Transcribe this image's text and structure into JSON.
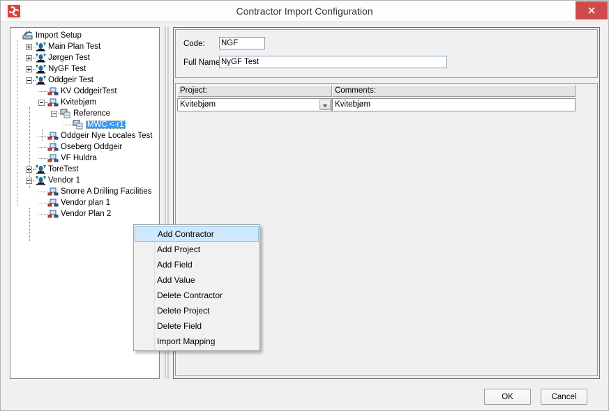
{
  "window": {
    "title": "Contractor Import Configuration",
    "app_icon": "app-logo-icon",
    "close_label": "✕"
  },
  "tree": {
    "root_label": "Import Setup",
    "nodes": [
      {
        "label": "Import Setup",
        "indent": 0,
        "icon": "import-setup-icon",
        "expander": "none",
        "selected": false
      },
      {
        "label": "Main Plan Test",
        "indent": 1,
        "icon": "contractor-icon",
        "expander": "plus",
        "selected": false
      },
      {
        "label": "Jørgen Test",
        "indent": 1,
        "icon": "contractor-icon",
        "expander": "plus",
        "selected": false
      },
      {
        "label": "NyGF Test",
        "indent": 1,
        "icon": "contractor-icon",
        "expander": "plus",
        "selected": false
      },
      {
        "label": "Oddgeir Test",
        "indent": 1,
        "icon": "contractor-icon",
        "expander": "minus",
        "selected": false
      },
      {
        "label": "KV OddgeirTest",
        "indent": 2,
        "icon": "project-icon",
        "expander": "none",
        "selected": false
      },
      {
        "label": "Kvitebjøm",
        "indent": 2,
        "icon": "project-icon",
        "expander": "minus",
        "selected": false
      },
      {
        "label": "Reference",
        "indent": 3,
        "icon": "field-icon",
        "expander": "minus",
        "selected": false
      },
      {
        "label": "MWC <-r1",
        "indent": 4,
        "icon": "field-icon",
        "expander": "none",
        "selected": true
      },
      {
        "label": "Oddgeir Nye Locales Test",
        "indent": 2,
        "icon": "project-icon",
        "expander": "none",
        "selected": false
      },
      {
        "label": "Oseberg Oddgeir",
        "indent": 2,
        "icon": "project-icon",
        "expander": "none",
        "selected": false
      },
      {
        "label": "VF Huldra",
        "indent": 2,
        "icon": "project-icon",
        "expander": "none",
        "selected": false
      },
      {
        "label": "ToreTest",
        "indent": 1,
        "icon": "contractor-icon",
        "expander": "plus",
        "selected": false
      },
      {
        "label": "Vendor 1",
        "indent": 1,
        "icon": "contractor-icon",
        "expander": "minus",
        "selected": false
      },
      {
        "label": "Snorre A Drilling Facilities",
        "indent": 2,
        "icon": "project-icon",
        "expander": "none",
        "selected": false
      },
      {
        "label": "Vendor plan 1",
        "indent": 2,
        "icon": "project-icon",
        "expander": "none",
        "selected": false
      },
      {
        "label": "Vendor Plan 2",
        "indent": 2,
        "icon": "project-icon",
        "expander": "none",
        "selected": false
      }
    ]
  },
  "details": {
    "code_label": "Code:",
    "code_value": "NGF",
    "fullname_label": "Full Name:",
    "fullname_value": "NyGF Test"
  },
  "list": {
    "columns": [
      "Project:",
      "Comments:"
    ],
    "rows": [
      {
        "project": "Kvitebjøm",
        "comments": "Kvitebjøm"
      }
    ]
  },
  "context_menu": {
    "items": [
      {
        "label": "Add Contractor",
        "highlighted": true
      },
      {
        "label": "Add Project",
        "highlighted": false
      },
      {
        "label": "Add Field",
        "highlighted": false
      },
      {
        "label": "Add Value",
        "highlighted": false
      },
      {
        "label": "Delete Contractor",
        "highlighted": false
      },
      {
        "label": "Delete Project",
        "highlighted": false
      },
      {
        "label": "Delete Field",
        "highlighted": false
      },
      {
        "label": "Import Mapping",
        "highlighted": false
      }
    ]
  },
  "footer": {
    "ok_label": "OK",
    "cancel_label": "Cancel"
  },
  "colors": {
    "titlebar": "#fdfdfd",
    "close_button": "#cf4a4a",
    "selection": "#3399ff",
    "menu_highlight": "#cde8ff",
    "window_bg": "#f0f0f0"
  }
}
